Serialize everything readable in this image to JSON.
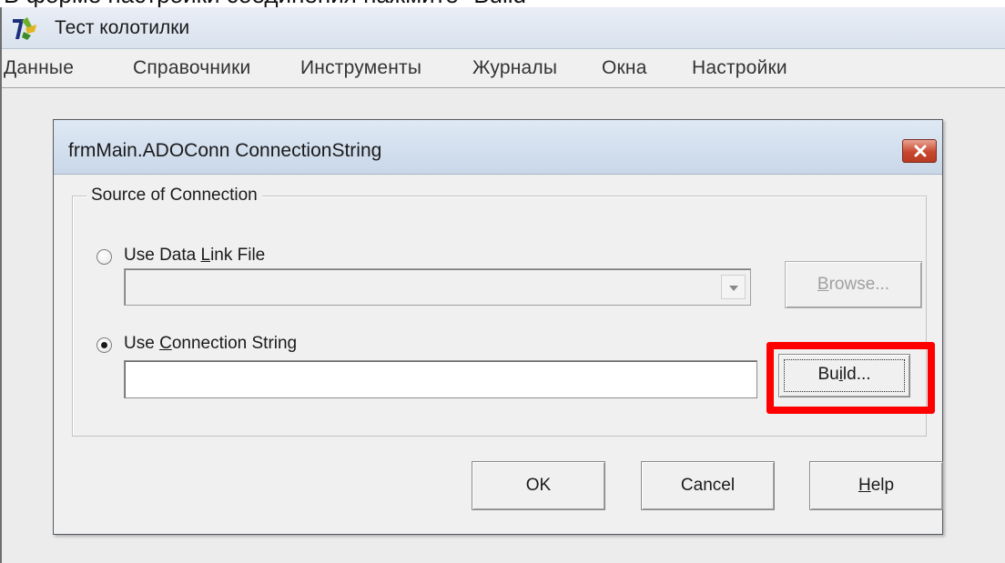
{
  "caption": {
    "text": "В форме настройки соединения нажмите \"Build\""
  },
  "app": {
    "title": "Тест колотилки",
    "icon": "app-logo-icon",
    "menu": [
      "Данные",
      "Справочники",
      "Инструменты",
      "Журналы",
      "Окна",
      "Настройки"
    ]
  },
  "dialog": {
    "title": "frmMain.ADOConn ConnectionString",
    "close_icon": "close-icon",
    "group_label": "Source of Connection",
    "radio_data_link": {
      "pre": "Use Data ",
      "accel": "L",
      "post": "ink File",
      "selected": false
    },
    "data_link_value": "",
    "browse": {
      "accel": "B",
      "post": "rowse...",
      "enabled": false
    },
    "radio_conn_string": {
      "pre": "Use ",
      "accel": "C",
      "post": "onnection String",
      "selected": true
    },
    "conn_string_value": "",
    "build": {
      "pre": "Bu",
      "accel": "i",
      "post": "ld..."
    },
    "ok_label": "OK",
    "cancel_label": "Cancel",
    "help": {
      "accel": "H",
      "post": "elp"
    }
  },
  "colors": {
    "highlight": "#ff0000",
    "close_button": "#c8462e"
  }
}
